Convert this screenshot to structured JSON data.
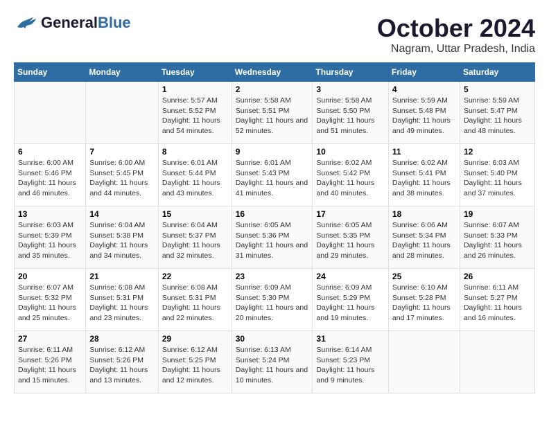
{
  "header": {
    "logo_general": "General",
    "logo_blue": "Blue",
    "month_title": "October 2024",
    "location": "Nagram, Uttar Pradesh, India"
  },
  "days_of_week": [
    "Sunday",
    "Monday",
    "Tuesday",
    "Wednesday",
    "Thursday",
    "Friday",
    "Saturday"
  ],
  "weeks": [
    [
      {
        "day": "",
        "sunrise": "",
        "sunset": "",
        "daylight": ""
      },
      {
        "day": "",
        "sunrise": "",
        "sunset": "",
        "daylight": ""
      },
      {
        "day": "1",
        "sunrise": "Sunrise: 5:57 AM",
        "sunset": "Sunset: 5:52 PM",
        "daylight": "Daylight: 11 hours and 54 minutes."
      },
      {
        "day": "2",
        "sunrise": "Sunrise: 5:58 AM",
        "sunset": "Sunset: 5:51 PM",
        "daylight": "Daylight: 11 hours and 52 minutes."
      },
      {
        "day": "3",
        "sunrise": "Sunrise: 5:58 AM",
        "sunset": "Sunset: 5:50 PM",
        "daylight": "Daylight: 11 hours and 51 minutes."
      },
      {
        "day": "4",
        "sunrise": "Sunrise: 5:59 AM",
        "sunset": "Sunset: 5:48 PM",
        "daylight": "Daylight: 11 hours and 49 minutes."
      },
      {
        "day": "5",
        "sunrise": "Sunrise: 5:59 AM",
        "sunset": "Sunset: 5:47 PM",
        "daylight": "Daylight: 11 hours and 48 minutes."
      }
    ],
    [
      {
        "day": "6",
        "sunrise": "Sunrise: 6:00 AM",
        "sunset": "Sunset: 5:46 PM",
        "daylight": "Daylight: 11 hours and 46 minutes."
      },
      {
        "day": "7",
        "sunrise": "Sunrise: 6:00 AM",
        "sunset": "Sunset: 5:45 PM",
        "daylight": "Daylight: 11 hours and 44 minutes."
      },
      {
        "day": "8",
        "sunrise": "Sunrise: 6:01 AM",
        "sunset": "Sunset: 5:44 PM",
        "daylight": "Daylight: 11 hours and 43 minutes."
      },
      {
        "day": "9",
        "sunrise": "Sunrise: 6:01 AM",
        "sunset": "Sunset: 5:43 PM",
        "daylight": "Daylight: 11 hours and 41 minutes."
      },
      {
        "day": "10",
        "sunrise": "Sunrise: 6:02 AM",
        "sunset": "Sunset: 5:42 PM",
        "daylight": "Daylight: 11 hours and 40 minutes."
      },
      {
        "day": "11",
        "sunrise": "Sunrise: 6:02 AM",
        "sunset": "Sunset: 5:41 PM",
        "daylight": "Daylight: 11 hours and 38 minutes."
      },
      {
        "day": "12",
        "sunrise": "Sunrise: 6:03 AM",
        "sunset": "Sunset: 5:40 PM",
        "daylight": "Daylight: 11 hours and 37 minutes."
      }
    ],
    [
      {
        "day": "13",
        "sunrise": "Sunrise: 6:03 AM",
        "sunset": "Sunset: 5:39 PM",
        "daylight": "Daylight: 11 hours and 35 minutes."
      },
      {
        "day": "14",
        "sunrise": "Sunrise: 6:04 AM",
        "sunset": "Sunset: 5:38 PM",
        "daylight": "Daylight: 11 hours and 34 minutes."
      },
      {
        "day": "15",
        "sunrise": "Sunrise: 6:04 AM",
        "sunset": "Sunset: 5:37 PM",
        "daylight": "Daylight: 11 hours and 32 minutes."
      },
      {
        "day": "16",
        "sunrise": "Sunrise: 6:05 AM",
        "sunset": "Sunset: 5:36 PM",
        "daylight": "Daylight: 11 hours and 31 minutes."
      },
      {
        "day": "17",
        "sunrise": "Sunrise: 6:05 AM",
        "sunset": "Sunset: 5:35 PM",
        "daylight": "Daylight: 11 hours and 29 minutes."
      },
      {
        "day": "18",
        "sunrise": "Sunrise: 6:06 AM",
        "sunset": "Sunset: 5:34 PM",
        "daylight": "Daylight: 11 hours and 28 minutes."
      },
      {
        "day": "19",
        "sunrise": "Sunrise: 6:07 AM",
        "sunset": "Sunset: 5:33 PM",
        "daylight": "Daylight: 11 hours and 26 minutes."
      }
    ],
    [
      {
        "day": "20",
        "sunrise": "Sunrise: 6:07 AM",
        "sunset": "Sunset: 5:32 PM",
        "daylight": "Daylight: 11 hours and 25 minutes."
      },
      {
        "day": "21",
        "sunrise": "Sunrise: 6:08 AM",
        "sunset": "Sunset: 5:31 PM",
        "daylight": "Daylight: 11 hours and 23 minutes."
      },
      {
        "day": "22",
        "sunrise": "Sunrise: 6:08 AM",
        "sunset": "Sunset: 5:31 PM",
        "daylight": "Daylight: 11 hours and 22 minutes."
      },
      {
        "day": "23",
        "sunrise": "Sunrise: 6:09 AM",
        "sunset": "Sunset: 5:30 PM",
        "daylight": "Daylight: 11 hours and 20 minutes."
      },
      {
        "day": "24",
        "sunrise": "Sunrise: 6:09 AM",
        "sunset": "Sunset: 5:29 PM",
        "daylight": "Daylight: 11 hours and 19 minutes."
      },
      {
        "day": "25",
        "sunrise": "Sunrise: 6:10 AM",
        "sunset": "Sunset: 5:28 PM",
        "daylight": "Daylight: 11 hours and 17 minutes."
      },
      {
        "day": "26",
        "sunrise": "Sunrise: 6:11 AM",
        "sunset": "Sunset: 5:27 PM",
        "daylight": "Daylight: 11 hours and 16 minutes."
      }
    ],
    [
      {
        "day": "27",
        "sunrise": "Sunrise: 6:11 AM",
        "sunset": "Sunset: 5:26 PM",
        "daylight": "Daylight: 11 hours and 15 minutes."
      },
      {
        "day": "28",
        "sunrise": "Sunrise: 6:12 AM",
        "sunset": "Sunset: 5:26 PM",
        "daylight": "Daylight: 11 hours and 13 minutes."
      },
      {
        "day": "29",
        "sunrise": "Sunrise: 6:12 AM",
        "sunset": "Sunset: 5:25 PM",
        "daylight": "Daylight: 11 hours and 12 minutes."
      },
      {
        "day": "30",
        "sunrise": "Sunrise: 6:13 AM",
        "sunset": "Sunset: 5:24 PM",
        "daylight": "Daylight: 11 hours and 10 minutes."
      },
      {
        "day": "31",
        "sunrise": "Sunrise: 6:14 AM",
        "sunset": "Sunset: 5:23 PM",
        "daylight": "Daylight: 11 hours and 9 minutes."
      },
      {
        "day": "",
        "sunrise": "",
        "sunset": "",
        "daylight": ""
      },
      {
        "day": "",
        "sunrise": "",
        "sunset": "",
        "daylight": ""
      }
    ]
  ]
}
